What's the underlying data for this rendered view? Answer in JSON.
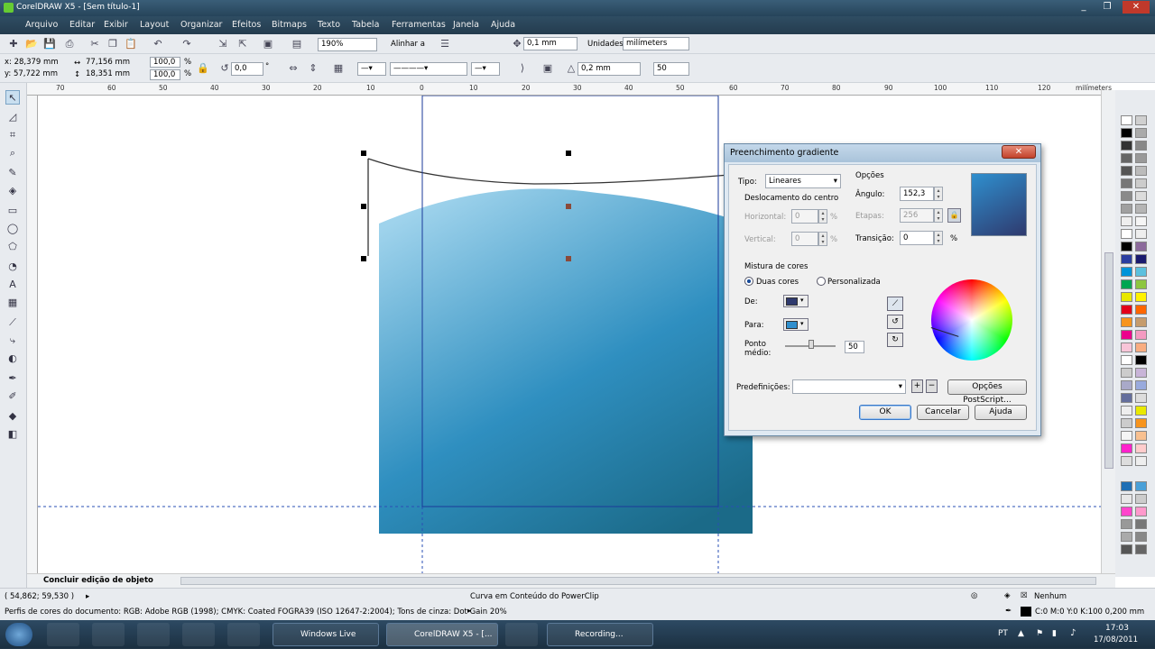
{
  "window": {
    "title": "CorelDRAW X5 - [Sem título-1]",
    "min": "_",
    "max": "❐",
    "close": "✕"
  },
  "menu": [
    "Arquivo",
    "Editar",
    "Exibir",
    "Layout",
    "Organizar",
    "Efeitos",
    "Bitmaps",
    "Texto",
    "Tabela",
    "Ferramentas",
    "Janela",
    "Ajuda"
  ],
  "toolbar1": {
    "zoom": "190%",
    "snap_label": "Alinhar a",
    "nudge": "0,1 mm",
    "units_label": "Unidades:",
    "units": "milímeters"
  },
  "toolbar2": {
    "x": "x: 28,379 mm",
    "y": "y: 57,722 mm",
    "w": "77,156 mm",
    "h": "18,351 mm",
    "sx": "100,0",
    "sy": "100,0",
    "pct": "%",
    "rotation": "0,0",
    "deg": "°",
    "outline_width": "0,2 mm",
    "spin_value": "50"
  },
  "ruler": {
    "unit": "milímeters",
    "labels": [
      "70",
      "60",
      "50",
      "40",
      "30",
      "20",
      "10",
      "0",
      "10",
      "20",
      "30",
      "40",
      "50",
      "60",
      "70",
      "80",
      "90",
      "100",
      "110",
      "120"
    ]
  },
  "status": {
    "tab": "Concluir edição de objeto",
    "coords": "( 54,862; 59,530 )",
    "object": "Curva em Conteúdo do PowerClip",
    "profile": "Perfis de cores do documento: RGB: Adobe RGB (1998); CMYK: Coated FOGRA39 (ISO 12647-2:2004); Tons de cinza: Dot Gain 20%",
    "fill": "Nenhum",
    "outline": "C:0 M:0 Y:0 K:100  0,200 mm"
  },
  "dialog": {
    "title": "Preenchimento gradiente",
    "tipo_label": "Tipo:",
    "tipo": "Lineares",
    "offset_label": "Deslocamento do centro",
    "horizontal_label": "Horizontal:",
    "horizontal": "0",
    "vertical_label": "Vertical:",
    "vertical": "0",
    "pct": "%",
    "options_label": "Opções",
    "angle_label": "Ângulo:",
    "angle": "152,3",
    "steps_label": "Etapas:",
    "steps": "256",
    "transition_label": "Transição:",
    "transition": "0",
    "mix_label": "Mistura de cores",
    "two_colors": "Duas cores",
    "custom": "Personalizada",
    "from_label": "De:",
    "to_label": "Para:",
    "from_color": "#2f3a6e",
    "to_color": "#2f8fce",
    "midpoint_label_1": "Ponto",
    "midpoint_label_2": "médio:",
    "midpoint": "50",
    "presets_label": "Predefinições:",
    "presets_value": "",
    "postscript": "Opções PostScript...",
    "ok": "OK",
    "cancel": "Cancelar",
    "help": "Ajuda"
  },
  "taskbar": {
    "items": [
      "Windows Live Me...",
      "CorelDRAW X5 - [...",
      "Recording..."
    ],
    "lang": "PT",
    "time": "17:03",
    "date": "17/08/2011"
  },
  "colors": {
    "accent_blue": "#2f8fce",
    "gradient_dark": "#1e6f8e",
    "gradient_light": "#93cde8"
  }
}
